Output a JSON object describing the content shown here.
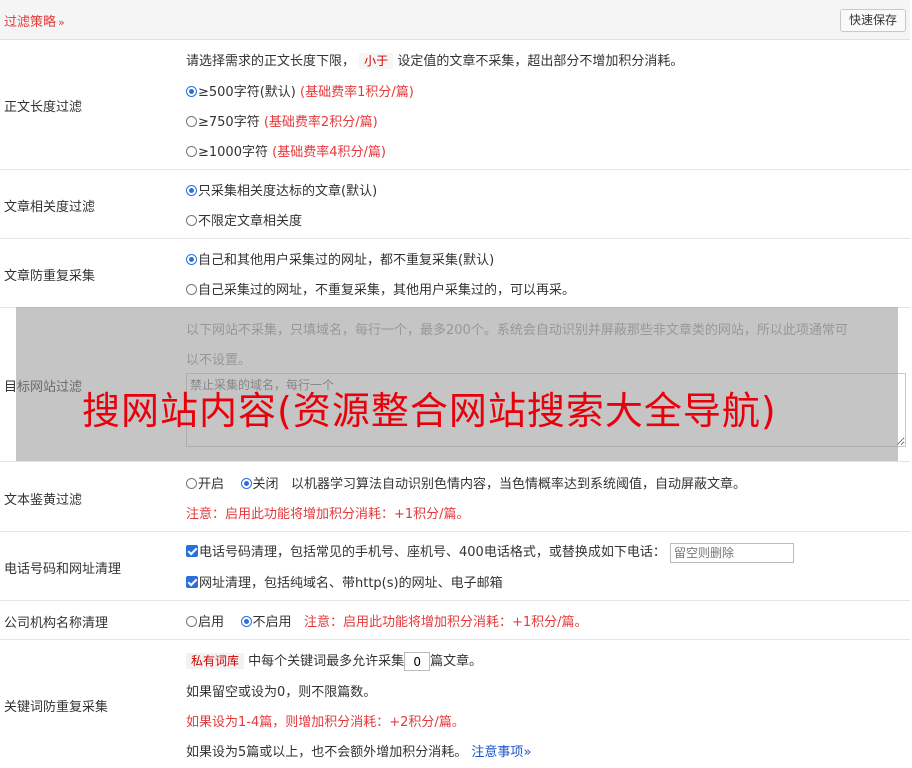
{
  "header": {
    "title": "过滤策略",
    "chevron": "»",
    "save_label": "快速保存"
  },
  "length_filter": {
    "label": "正文长度过滤",
    "desc_pre": "请选择需求的正文长度下限，",
    "desc_tag": "小于",
    "desc_post": "设定值的文章不采集，超出部分不增加积分消耗。",
    "options": [
      {
        "text": "≥500字符(默认)",
        "rate": "(基础费率1积分/篇)",
        "checked": true
      },
      {
        "text": "≥750字符",
        "rate": "(基础费率2积分/篇)",
        "checked": false
      },
      {
        "text": "≥1000字符",
        "rate": "(基础费率4积分/篇)",
        "checked": false
      }
    ]
  },
  "relevance": {
    "label": "文章相关度过滤",
    "options": [
      {
        "text": "只采集相关度达标的文章(默认)",
        "checked": true
      },
      {
        "text": "不限定文章相关度",
        "checked": false
      }
    ]
  },
  "dedup": {
    "label": "文章防重复采集",
    "options": [
      {
        "text": "自己和其他用户采集过的网址，都不重复采集(默认)",
        "checked": true
      },
      {
        "text": "自己采集过的网址，不重复采集，其他用户采集过的，可以再采。",
        "checked": false
      }
    ]
  },
  "target_site": {
    "label": "目标网站过滤",
    "desc_line1": "以下网站不采集，只填域名，每行一个，最多200个。系统会自动识别并屏蔽那些非文章类的网站，所以此项通常可",
    "desc_line2": "以不设置。",
    "placeholder": "禁止采集的域名，每行一个"
  },
  "porn": {
    "label": "文本鉴黄过滤",
    "opt_on": "开启",
    "opt_off": "关闭",
    "desc": "以机器学习算法自动识别色情内容，当色情概率达到系统阈值，自动屏蔽文章。",
    "note": "注意：启用此功能将增加积分消耗：+1积分/篇。"
  },
  "phone": {
    "label": "电话号码和网址清理",
    "phone_text": "电话号码清理，包括常见的手机号、座机号、400电话格式，或替换成如下电话：",
    "phone_placeholder": "留空则删除",
    "url_text": "网址清理，包括纯域名、带http(s)的网址、电子邮箱"
  },
  "company": {
    "label": "公司机构名称清理",
    "opt_on": "启用",
    "opt_off": "不启用",
    "note": "注意：启用此功能将增加积分消耗：+1积分/篇。"
  },
  "keyword": {
    "label": "关键词防重复采集",
    "tag": "私有词库",
    "text_pre": "中每个关键词最多允许采集",
    "value": "0",
    "text_post": "篇文章。",
    "line2": "如果留空或设为0，则不限篇数。",
    "line3": "如果设为1-4篇，则增加积分消耗：+2积分/篇。",
    "line4": "如果设为5篇或以上，也不会额外增加积分消耗。",
    "link": "注意事项",
    "link_chevron": "»"
  },
  "overlay": {
    "text": "搜网站内容(资源整合网站搜索大全导航)"
  },
  "colors": {
    "accent_red": "#e4393c",
    "radio_blue": "#2a6fdb",
    "link_blue": "#1a55c8"
  }
}
